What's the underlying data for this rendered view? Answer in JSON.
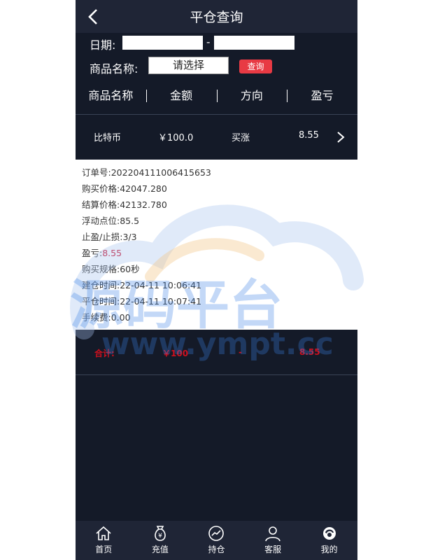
{
  "header": {
    "title": "平仓查询"
  },
  "filters": {
    "date_label": "日期:",
    "date_separator": "-",
    "product_label": "商品名称:",
    "product_select": "请选择",
    "query_button": "查询"
  },
  "columns": [
    "商品名称",
    "金额",
    "方向",
    "盈亏"
  ],
  "record": {
    "name": "比特币",
    "amount": "￥100.0",
    "direction": "买涨",
    "pnl": "8.55"
  },
  "details": [
    {
      "label": "订单号:",
      "value": "202204111006415653"
    },
    {
      "label": "购买价格:",
      "value": "42047.280"
    },
    {
      "label": "结算价格:",
      "value": "42132.780"
    },
    {
      "label": "浮动点位:",
      "value": "85.5"
    },
    {
      "label": "止盈/止损:",
      "value": "3/3"
    },
    {
      "label": "盈亏:",
      "value": "8.55"
    },
    {
      "label": "购买规格:",
      "value": "60秒"
    },
    {
      "label": "建仓时间:",
      "value": "22-04-11 10:06:41"
    },
    {
      "label": "平仓时间:",
      "value": "22-04-11 10:07:41"
    },
    {
      "label": "手续费:",
      "value": "0.00"
    }
  ],
  "summary": {
    "label": "合计:",
    "amount": "￥100",
    "direction": "-",
    "pnl": "8.55"
  },
  "nav": [
    {
      "label": "首页",
      "icon": "home-icon"
    },
    {
      "label": "充值",
      "icon": "money-bag-icon"
    },
    {
      "label": "持仓",
      "icon": "chart-icon"
    },
    {
      "label": "客服",
      "icon": "user-icon"
    },
    {
      "label": "我的",
      "icon": "avatar-icon"
    }
  ],
  "watermark": {
    "text_cn": "源码平台",
    "text_url": "www.ympt.cc"
  },
  "colors": {
    "background": "#141a28",
    "header": "#1f2536",
    "accent_red": "#e83a44",
    "profit_red": "#c8102e"
  }
}
